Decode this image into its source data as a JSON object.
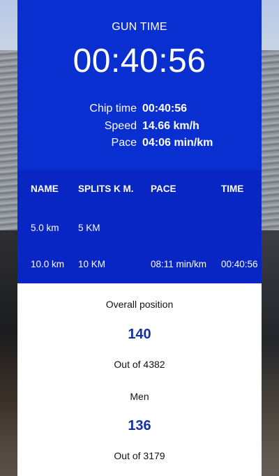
{
  "gun_time": {
    "label": "GUN TIME",
    "value": "00:40:56"
  },
  "stats": [
    {
      "key": "Chip time",
      "value": "00:40:56"
    },
    {
      "key": "Speed",
      "value": "14.66 km/h"
    },
    {
      "key": "Pace",
      "value": "04:06 min/km"
    }
  ],
  "splits": {
    "headers": [
      "NAME",
      "SPLITS K M.",
      "PACE",
      "TIME"
    ],
    "rows": [
      {
        "name": "5.0 km",
        "split": "5 KM",
        "pace": "",
        "time": ""
      },
      {
        "name": "10.0 km",
        "split": "10 KM",
        "pace": "08:11 min/km",
        "time": "00:40:56"
      }
    ]
  },
  "overall": {
    "label": "Overall position",
    "value": "140",
    "out_of": "Out of 4382"
  },
  "category": {
    "label": "Men",
    "value": "136",
    "out_of": "Out of 3179"
  },
  "colors": {
    "primary_blue": "#0a2fd0",
    "table_blue": "#0826c3",
    "number_blue": "#1230a8"
  }
}
